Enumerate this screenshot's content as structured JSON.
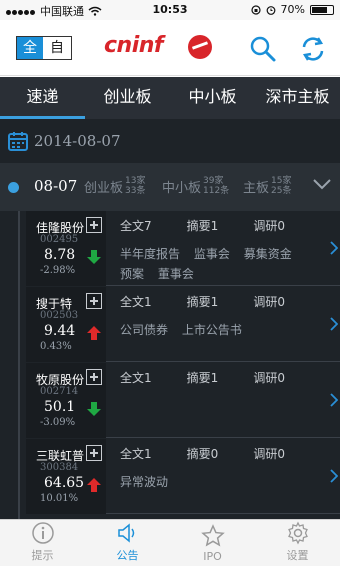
{
  "status_bar": {
    "carrier": "中国联通",
    "time": "10:53",
    "battery": "70%"
  },
  "header": {
    "mode_left": "全",
    "mode_right": "自",
    "logo": "cninf"
  },
  "tabs": [
    {
      "label": "速递",
      "active": true
    },
    {
      "label": "创业板",
      "active": false
    },
    {
      "label": "中小板",
      "active": false
    },
    {
      "label": "深市主板",
      "active": false
    }
  ],
  "date_bar": {
    "date": "2014-08-07"
  },
  "day_bar": {
    "day": "08-07",
    "boards": [
      {
        "name": "创业板",
        "count_top": "13家",
        "count_bottom": "33条"
      },
      {
        "name": "中小板",
        "count_top": "39家",
        "count_bottom": "112条"
      },
      {
        "name": "主板",
        "count_top": "15家",
        "count_bottom": "25条"
      }
    ]
  },
  "rows": [
    {
      "name": "佳隆股份",
      "code": "002495",
      "price": "8.78",
      "change": "-2.98%",
      "direction": "down",
      "fulltext": "全文7",
      "summary": "摘要1",
      "research": "调研0",
      "tags": [
        "半年度报告",
        "监事会",
        "募集资金",
        "预案",
        "董事会"
      ]
    },
    {
      "name": "搜于特",
      "code": "002503",
      "price": "9.44",
      "change": "0.43%",
      "direction": "up",
      "fulltext": "全文1",
      "summary": "摘要1",
      "research": "调研0",
      "tags": [
        "公司债券",
        "上市公告书"
      ]
    },
    {
      "name": "牧原股份",
      "code": "002714",
      "price": "50.1",
      "change": "-3.09%",
      "direction": "down",
      "fulltext": "全文1",
      "summary": "摘要1",
      "research": "调研0",
      "tags": []
    },
    {
      "name": "三联虹普",
      "code": "300384",
      "price": "64.65",
      "change": "10.01%",
      "direction": "up",
      "fulltext": "全文1",
      "summary": "摘要0",
      "research": "调研0",
      "tags": [
        "异常波动"
      ]
    }
  ],
  "bottom_nav": [
    {
      "label": "提示",
      "icon": "info-icon",
      "active": false
    },
    {
      "label": "公告",
      "icon": "speaker-icon",
      "active": true
    },
    {
      "label": "IPO",
      "icon": "star-icon",
      "active": false
    },
    {
      "label": "设置",
      "icon": "gear-icon",
      "active": false
    }
  ],
  "colors": {
    "accent": "#1a8fd8",
    "logo": "#d8252a",
    "up": "#e02a2a",
    "down": "#1fa843"
  }
}
